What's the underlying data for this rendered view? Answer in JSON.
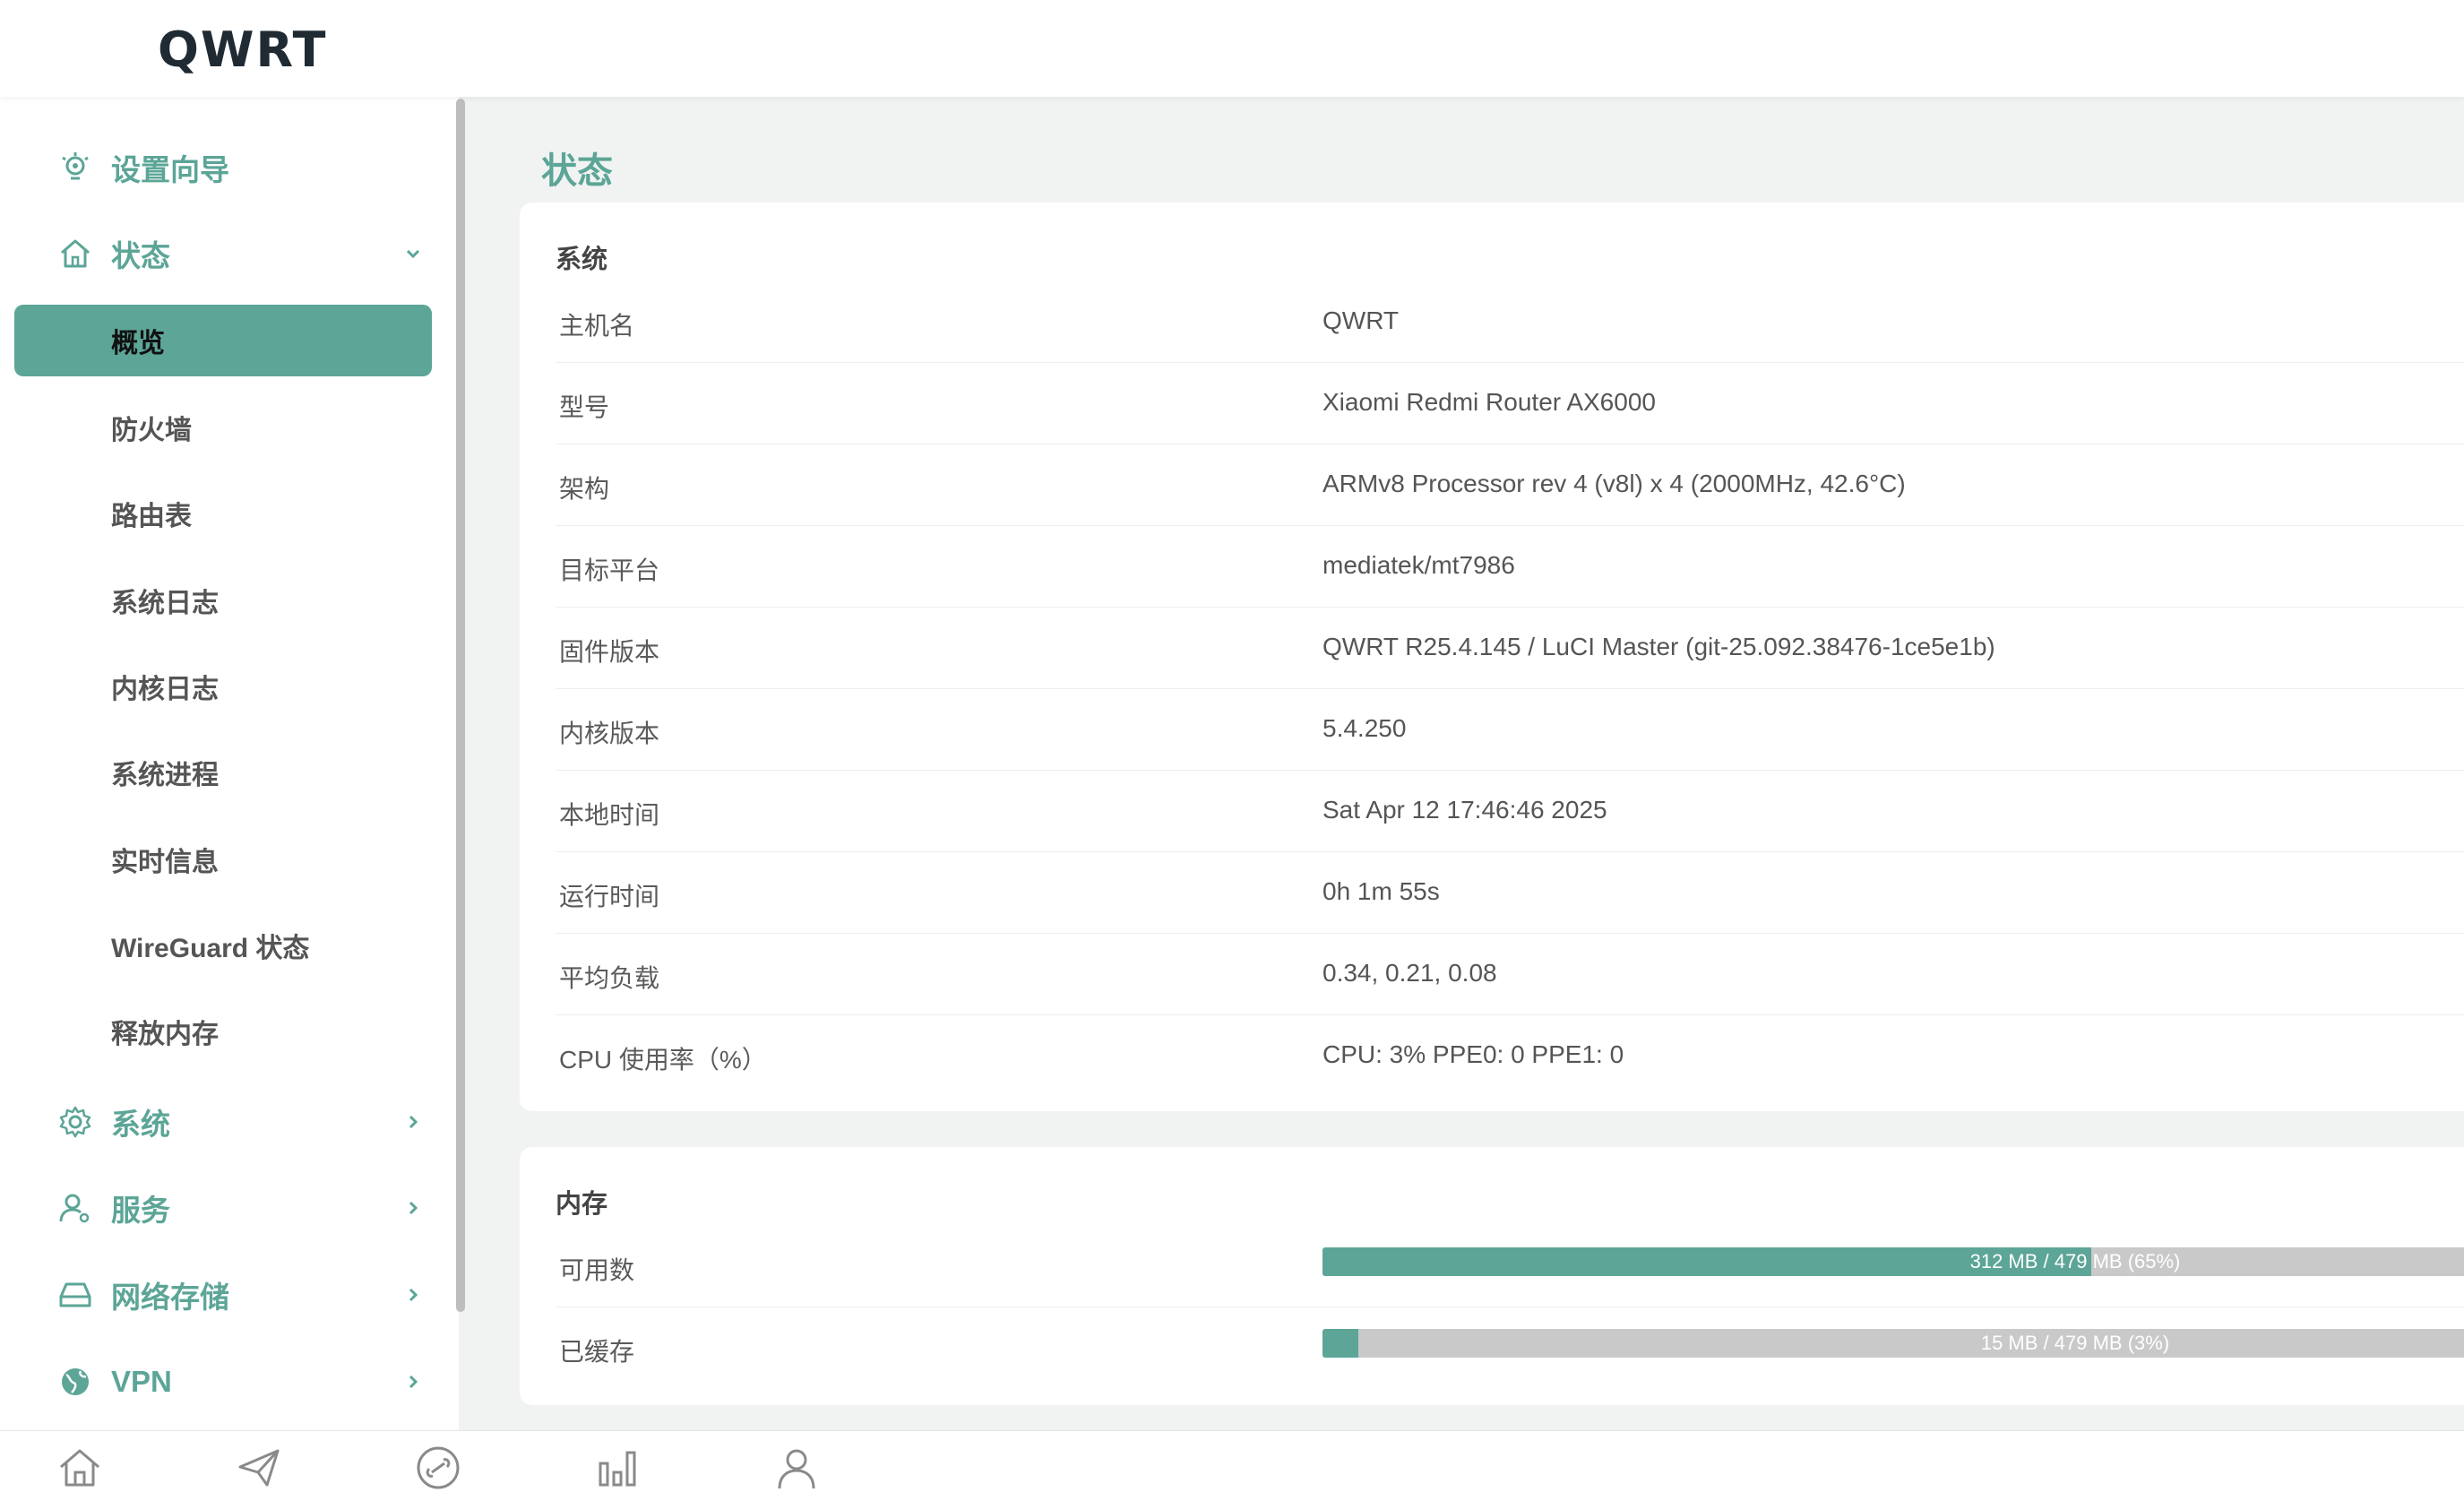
{
  "app": {
    "brand": "QWRT"
  },
  "page": {
    "title": "状态"
  },
  "sidebar": {
    "wizard": {
      "label": "设置向导",
      "icon": "lightbulb-gear-icon"
    },
    "status": {
      "label": "状态",
      "icon": "home-icon",
      "items": [
        {
          "label": "概览",
          "active": true
        },
        {
          "label": "防火墙"
        },
        {
          "label": "路由表"
        },
        {
          "label": "系统日志"
        },
        {
          "label": "内核日志"
        },
        {
          "label": "系统进程"
        },
        {
          "label": "实时信息"
        },
        {
          "label": "WireGuard 状态"
        },
        {
          "label": "释放内存"
        }
      ]
    },
    "system": {
      "label": "系统",
      "icon": "gear-icon"
    },
    "services": {
      "label": "服务",
      "icon": "user-service-icon"
    },
    "storage": {
      "label": "网络存储",
      "icon": "drive-icon"
    },
    "vpn": {
      "label": "VPN",
      "icon": "globe-icon"
    }
  },
  "system_card": {
    "title": "系统",
    "rows": [
      {
        "key": "主机名",
        "value": "QWRT"
      },
      {
        "key": "型号",
        "value": "Xiaomi Redmi Router AX6000"
      },
      {
        "key": "架构",
        "value": "ARMv8 Processor rev 4 (v8l) x 4 (2000MHz, 42.6°C)"
      },
      {
        "key": "目标平台",
        "value": "mediatek/mt7986"
      },
      {
        "key": "固件版本",
        "value": "QWRT R25.4.145 / LuCI Master (git-25.092.38476-1ce5e1b)"
      },
      {
        "key": "内核版本",
        "value": "5.4.250"
      },
      {
        "key": "本地时间",
        "value": "Sat Apr 12 17:46:46 2025"
      },
      {
        "key": "运行时间",
        "value": "0h 1m 55s"
      },
      {
        "key": "平均负载",
        "value": "0.34, 0.21, 0.08"
      },
      {
        "key": "CPU 使用率（%）",
        "value": "CPU: 3% PPE0: 0 PPE1: 0"
      }
    ]
  },
  "memory_card": {
    "title": "内存",
    "rows": [
      {
        "key": "可用数",
        "bar_text": "312 MB / 479 MB (65%)",
        "percent": 65
      },
      {
        "key": "已缓存",
        "bar_text": "15 MB / 479 MB (3%)",
        "percent": 3
      }
    ]
  },
  "bottom_bar": {
    "icons": [
      "home-icon",
      "paper-plane-icon",
      "link-icon",
      "bar-chart-icon",
      "user-icon"
    ]
  },
  "colors": {
    "accent": "#5ca597",
    "bar_bg": "#c9c9c9"
  }
}
